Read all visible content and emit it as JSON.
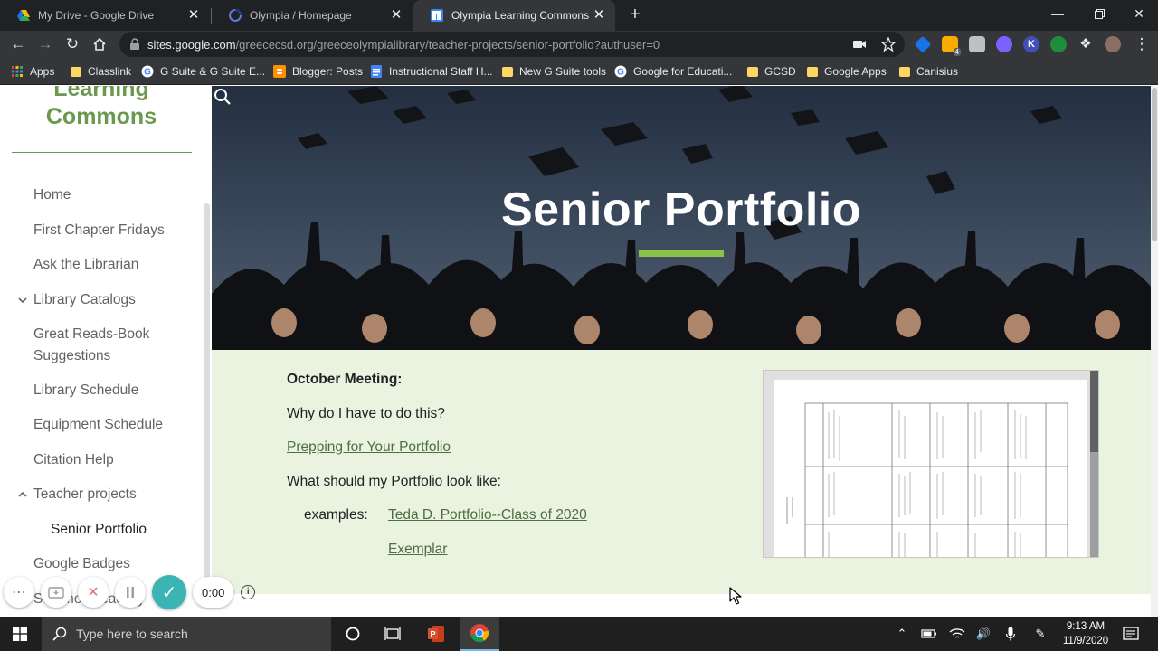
{
  "browser": {
    "tabs": [
      {
        "title": "My Drive - Google Drive",
        "icon": "google-drive-icon",
        "active": false
      },
      {
        "title": "Olympia / Homepage",
        "icon": "olympia-icon",
        "active": false
      },
      {
        "title": "Olympia Learning Commons - Se",
        "icon": "google-sites-icon",
        "active": true
      }
    ],
    "url_host": "sites.google.com",
    "url_path": "/greececsd.org/greeceolympialibrary/teacher-projects/senior-portfolio?authuser=0",
    "bookmarks": [
      {
        "label": "Apps",
        "icon": "apps-grid-icon"
      },
      {
        "label": "Classlink",
        "icon": "folder-icon"
      },
      {
        "label": "G Suite & G Suite E...",
        "icon": "google-icon"
      },
      {
        "label": "Blogger: Posts",
        "icon": "blogger-icon"
      },
      {
        "label": "Instructional Staff H...",
        "icon": "docs-icon"
      },
      {
        "label": "New G Suite tools",
        "icon": "folder-icon"
      },
      {
        "label": "Google for Educati...",
        "icon": "google-icon"
      },
      {
        "label": "GCSD",
        "icon": "folder-icon"
      },
      {
        "label": "Google Apps",
        "icon": "folder-icon"
      },
      {
        "label": "Canisius",
        "icon": "folder-icon"
      }
    ],
    "extension_badge": "4"
  },
  "site": {
    "name": "Learning Commons",
    "nav": [
      {
        "label": "Home"
      },
      {
        "label": "First Chapter Fridays"
      },
      {
        "label": "Ask the Librarian"
      },
      {
        "label": "Library Catalogs"
      },
      {
        "label": "Great Reads-Book Suggestions"
      },
      {
        "label": "Library Schedule"
      },
      {
        "label": "Equipment Schedule"
      },
      {
        "label": "Citation Help"
      },
      {
        "label": "Teacher projects"
      },
      {
        "label": "Senior Portfolio"
      },
      {
        "label": "Google Badges"
      },
      {
        "label": "Summer Reading"
      }
    ]
  },
  "hero": {
    "title": "Senior Portfolio"
  },
  "content": {
    "heading": "October Meeting:",
    "question1": "Why do I have to do this?",
    "link_prepping": "Prepping for Your Portfolio",
    "question2": "What should my Portfolio look like:",
    "examples_label": "examples:",
    "link_example1": "Teda D. Portfolio--Class of 2020",
    "link_example2": "Exemplar"
  },
  "recorder": {
    "time": "0:00"
  },
  "taskbar": {
    "search_placeholder": "Type here to search",
    "time": "9:13 AM",
    "date": "11/9/2020"
  },
  "colors": {
    "accent_green": "#6a994e",
    "hero_rule": "#8bc34a",
    "content_bg": "#e9f3df",
    "link_color": "#4e6e43"
  }
}
